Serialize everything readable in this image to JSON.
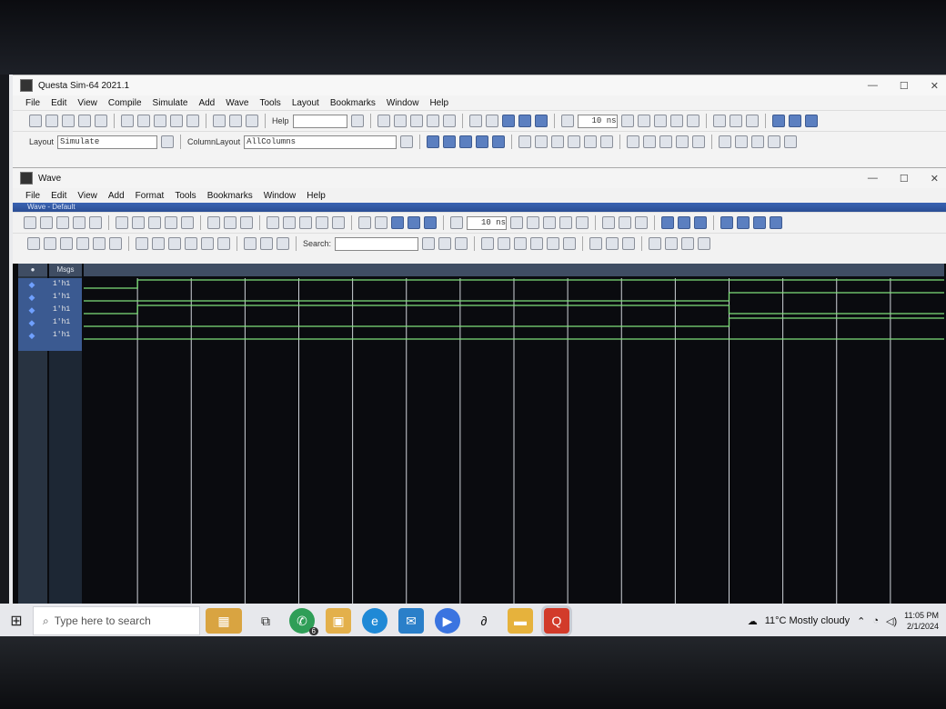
{
  "main_window": {
    "title": "Questa Sim-64 2021.1",
    "menu": [
      "File",
      "Edit",
      "View",
      "Compile",
      "Simulate",
      "Add",
      "Wave",
      "Tools",
      "Layout",
      "Bookmarks",
      "Window",
      "Help"
    ],
    "help_label": "Help",
    "time_step_value": "10 ns",
    "layout_label": "Layout",
    "layout_value": "Simulate",
    "column_layout_label": "ColumnLayout",
    "column_layout_value": "AllColumns"
  },
  "wave_window": {
    "title": "Wave",
    "menu": [
      "File",
      "Edit",
      "View",
      "Add",
      "Format",
      "Tools",
      "Bookmarks",
      "Window",
      "Help"
    ],
    "subtitle": "Wave - Default",
    "time_step_value": "10 ns",
    "search_label": "Search:",
    "msgs_header": "Msgs",
    "signals": [
      {
        "value": "1'h1",
        "waveform": [
          0,
          1,
          1,
          1,
          1,
          1,
          1,
          1,
          1,
          1,
          1,
          1,
          1,
          1,
          1,
          1
        ]
      },
      {
        "value": "1'h1",
        "waveform": [
          0,
          0,
          0,
          0,
          0,
          0,
          0,
          0,
          0,
          0,
          0,
          0,
          1,
          1,
          1,
          1
        ]
      },
      {
        "value": "1'h1",
        "waveform": [
          0,
          1,
          1,
          1,
          1,
          1,
          1,
          1,
          1,
          1,
          1,
          1,
          0,
          0,
          0,
          0
        ]
      },
      {
        "value": "1'h1",
        "waveform": [
          0,
          0,
          0,
          0,
          0,
          0,
          0,
          0,
          0,
          0,
          0,
          0,
          1,
          1,
          1,
          1
        ]
      },
      {
        "value": "1'h1",
        "waveform": [
          0,
          0,
          0,
          0,
          0,
          0,
          0,
          0,
          0,
          0,
          0,
          0,
          0,
          0,
          0,
          0
        ]
      }
    ]
  },
  "taskbar": {
    "search_placeholder": "Type here to search",
    "whatsapp_badge": "6",
    "weather": "11°C  Mostly cloudy",
    "time": "11:05 PM",
    "date": "2/1/2024"
  }
}
